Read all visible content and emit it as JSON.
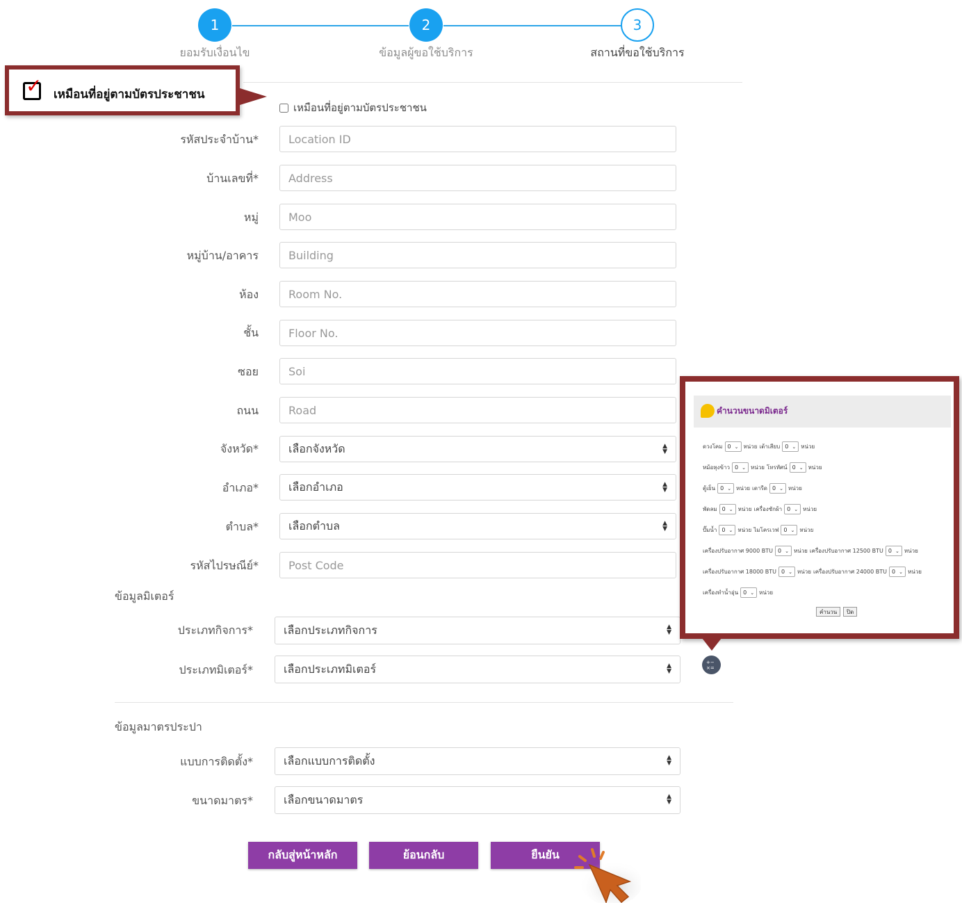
{
  "stepper": {
    "steps": [
      {
        "number": "1",
        "label": "ยอมรับเงื่อนไข"
      },
      {
        "number": "2",
        "label": "ข้อมูลผู้ขอใช้บริการ"
      },
      {
        "number": "3",
        "label": "สถานที่ขอใช้บริการ"
      }
    ],
    "current": 3,
    "accent_color": "#19a1f0"
  },
  "callout": {
    "text": "เหมือนที่อยู่ตามบัตรประชาชน",
    "check_glyph": "✓",
    "border_color": "#8b2d2d"
  },
  "same_address": {
    "label": "เหมือนที่อยู่ตามบัตรประชาชน",
    "checked": false
  },
  "location": {
    "fields": [
      {
        "label": "รหัสประจำบ้าน*",
        "placeholder": "Location ID"
      },
      {
        "label": "บ้านเลขที่*",
        "placeholder": "Address"
      },
      {
        "label": "หมู่",
        "placeholder": "Moo"
      },
      {
        "label": "หมู่บ้าน/อาคาร",
        "placeholder": "Building"
      },
      {
        "label": "ห้อง",
        "placeholder": "Room No."
      },
      {
        "label": "ชั้น",
        "placeholder": "Floor No."
      },
      {
        "label": "ซอย",
        "placeholder": "Soi"
      },
      {
        "label": "ถนน",
        "placeholder": "Road"
      }
    ],
    "province": {
      "label": "จังหวัด*",
      "value": "เลือกจังหวัด"
    },
    "district": {
      "label": "อำเภอ*",
      "value": "เลือกอำเภอ"
    },
    "subdistrict": {
      "label": "ตำบล*",
      "value": "เลือกตำบล"
    },
    "postcode": {
      "label": "รหัสไปรษณีย์*",
      "placeholder": "Post Code"
    }
  },
  "meter_info": {
    "title": "ข้อมูลมิเตอร์",
    "business_type": {
      "label": "ประเภทกิจการ*",
      "value": "เลือกประเภทกิจการ"
    },
    "meter_type": {
      "label": "ประเภทมิเตอร์*",
      "value": "เลือกประเภทมิเตอร์"
    }
  },
  "water_meter": {
    "title": "ข้อมูลมาตรประปา",
    "install_type": {
      "label": "แบบการติดตั้ง*",
      "value": "เลือกแบบการติดตั้ง"
    },
    "meter_size": {
      "label": "ขนาดมาตร*",
      "value": "เลือกขนาดมาตร"
    }
  },
  "buttons": {
    "home": "กลับสู่หน้าหลัก",
    "back": "ย้อนกลับ",
    "confirm": "ยืนยัน",
    "color": "#8e3da6"
  },
  "calculator": {
    "title": "คำนวนขนาดมิเตอร์",
    "unit": "หน่วย",
    "default_value": "0",
    "rows": [
      [
        {
          "label": "ดวงโคม"
        },
        {
          "label": "เต้าเสียบ"
        }
      ],
      [
        {
          "label": "หม้อหุงข้าว"
        },
        {
          "label": "โทรทัศน์"
        }
      ],
      [
        {
          "label": "ตู้เย็น"
        },
        {
          "label": "เตารีด"
        }
      ],
      [
        {
          "label": "พัดลม"
        },
        {
          "label": "เครื่องซักผ้า"
        }
      ],
      [
        {
          "label": "ปั๊มน้ำ"
        },
        {
          "label": "ไมโครเวฟ"
        }
      ],
      [
        {
          "label": "เครื่องปรับอากาศ 9000 BTU"
        },
        {
          "label": "เครื่องปรับอากาศ 12500 BTU"
        }
      ],
      [
        {
          "label": "เครื่องปรับอากาศ 18000 BTU"
        },
        {
          "label": "เครื่องปรับอากาศ 24000 BTU"
        }
      ],
      [
        {
          "label": "เครื่องทำน้ำอุ่น"
        }
      ]
    ],
    "calc_button": "คำนวน",
    "close_button": "ปิด"
  },
  "icons": {
    "calculator": "calculator-icon",
    "cursor": "click-cursor-icon"
  }
}
